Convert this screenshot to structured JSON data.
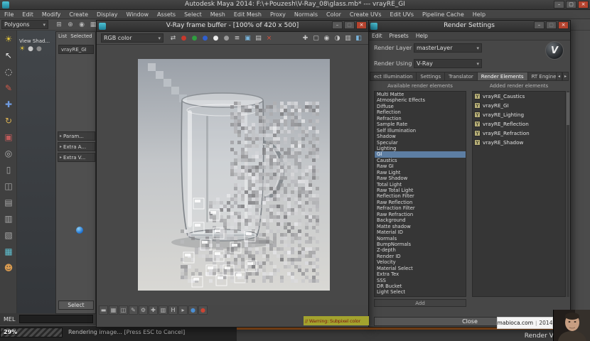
{
  "icons": {
    "minimize": "–",
    "maximize": "▢",
    "close": "×",
    "dropdown_arrow": "▾",
    "section_arrow": "▸",
    "tab_scroll_left": "◂",
    "tab_scroll_right": "▸"
  },
  "maya": {
    "title": "Autodesk Maya 2014: F:\\+Pouzesh\\V-Ray_08\\glass.mb* --- vrayRE_GI",
    "menus": [
      "File",
      "Edit",
      "Modify",
      "Create",
      "Display",
      "Window",
      "Assets",
      "Select",
      "Mesh",
      "Edit Mesh",
      "Proxy",
      "Normals",
      "Color",
      "Create UVs",
      "Edit UVs",
      "Pipeline Cache",
      "Help"
    ],
    "menuset": "Polygons",
    "panel_menu_hint": "View Shad...",
    "mel_label": "MEL",
    "progress_percent": "29%",
    "help_line": "Rendering image... [Press ESC to Cancel]",
    "warning_line": "// Warning: Subpixel color",
    "render_view_label": "Render View",
    "watermark_site": "mabioca.com",
    "watermark_sep": "|",
    "watermark_year": "2014",
    "toolbox_icons": [
      {
        "name": "render-light-icon",
        "glyph": "☀",
        "color": "#e3c43a"
      },
      {
        "name": "select-tool-icon",
        "glyph": "↖",
        "color": "#e8e8e8"
      },
      {
        "name": "lasso-tool-icon",
        "glyph": "◌",
        "color": "#d8d8d8"
      },
      {
        "name": "paint-select-tool-icon",
        "glyph": "✎",
        "color": "#d05a4a"
      },
      {
        "name": "move-tool-icon",
        "glyph": "✚",
        "color": "#6f9be0"
      },
      {
        "name": "rotate-tool-icon",
        "glyph": "↻",
        "color": "#d8b052"
      },
      {
        "name": "scale-tool-icon",
        "glyph": "▣",
        "color": "#c05a5a"
      },
      {
        "name": "last-tool-icon",
        "glyph": "◎",
        "color": "#b0b0b0"
      },
      {
        "name": "layout-single-icon",
        "glyph": "▯",
        "color": "#a8a8a8"
      },
      {
        "name": "layout-four-icon",
        "glyph": "◫",
        "color": "#a8a8a8"
      },
      {
        "name": "layout-split-icon",
        "glyph": "▤",
        "color": "#a8a8a8"
      },
      {
        "name": "layout-persp-outliner-icon",
        "glyph": "▥",
        "color": "#a8a8a8"
      },
      {
        "name": "layout-hypershade-icon",
        "glyph": "▧",
        "color": "#a8a8a8"
      },
      {
        "name": "grid-snap-icon",
        "glyph": "▦",
        "color": "#5fc0d0"
      },
      {
        "name": "character-icon",
        "glyph": "☻",
        "color": "#d89a50"
      }
    ],
    "shelf_icons": [
      {
        "name": "snap-grid-icon",
        "glyph": "⊞",
        "color": "#b8b8b8"
      },
      {
        "name": "snap-curve-icon",
        "glyph": "⊕",
        "color": "#b8b8b8"
      },
      {
        "name": "snap-point-icon",
        "glyph": "◉",
        "color": "#b8b8b8"
      },
      {
        "name": "snap-view-icon",
        "glyph": "▦",
        "color": "#b8b8b8"
      }
    ],
    "viewport_icons": [
      {
        "name": "viewport-light-icon",
        "glyph": "☀",
        "color": "#e3c43a"
      },
      {
        "name": "viewport-sphere-icon",
        "glyph": "●",
        "color": "#c8c8c8"
      },
      {
        "name": "viewport-sphere2-icon",
        "glyph": "●",
        "color": "#8a8a8a"
      }
    ]
  },
  "attribute_editor": {
    "menus": [
      "List",
      "Selected"
    ],
    "tab": "vrayRE_GI",
    "sections": [
      "Param...",
      "Extra A...",
      "Extra V..."
    ],
    "select_button": "Select"
  },
  "framebuffer": {
    "title": "V-Ray frame buffer - [100% of 420 x 500]",
    "channel": "RGB color",
    "toolbar_icons_left": [
      {
        "name": "swap-buffers-icon",
        "glyph": "⇄",
        "color": "#d0d0d0"
      },
      {
        "name": "red-channel-icon",
        "glyph": "●",
        "color": "#c8382c"
      },
      {
        "name": "green-channel-icon",
        "glyph": "●",
        "color": "#2f9e3f"
      },
      {
        "name": "blue-channel-icon",
        "glyph": "●",
        "color": "#2f5fd0"
      },
      {
        "name": "alpha-channel-icon",
        "glyph": "●",
        "color": "#ececec"
      },
      {
        "name": "mono-channel-icon",
        "glyph": "●",
        "color": "#9a9a9a"
      },
      {
        "name": "channels-menu-icon",
        "glyph": "≡",
        "color": "#d8d8d8"
      },
      {
        "name": "save-image-icon",
        "glyph": "▣",
        "color": "#79b5dd"
      },
      {
        "name": "load-image-icon",
        "glyph": "▤",
        "color": "#c8c8c8"
      },
      {
        "name": "clear-image-icon",
        "glyph": "×",
        "color": "#d8503c"
      }
    ],
    "toolbar_icons_right": [
      {
        "name": "follow-mouse-icon",
        "glyph": "✚",
        "color": "#c8c8c8"
      },
      {
        "name": "region-render-icon",
        "glyph": "▢",
        "color": "#c8c8c8"
      },
      {
        "name": "pixel-info-icon",
        "glyph": "◉",
        "color": "#c8c8c8"
      },
      {
        "name": "color-correction-icon",
        "glyph": "◑",
        "color": "#c8c8c8"
      },
      {
        "name": "levels-icon",
        "glyph": "▥",
        "color": "#c8c8c8"
      },
      {
        "name": "compare-icon",
        "glyph": "◧",
        "color": "#79b5dd"
      }
    ],
    "bottom_icons": [
      {
        "name": "minimize-panel-icon",
        "glyph": "▬",
        "color": "#b8b8b8"
      },
      {
        "name": "show-alpha-icon",
        "glyph": "▦",
        "color": "#b8b8b8"
      },
      {
        "name": "pixel-aspect-icon",
        "glyph": "◫",
        "color": "#b8b8b8"
      },
      {
        "name": "stamp-edit-icon",
        "glyph": "✎",
        "color": "#b8b8b8"
      },
      {
        "name": "settings-gear-icon",
        "glyph": "⚙",
        "color": "#b8b8b8"
      },
      {
        "name": "crosshair-icon",
        "glyph": "✚",
        "color": "#b8b8b8"
      },
      {
        "name": "histogram-icon",
        "glyph": "▥",
        "color": "#b8b8b8"
      },
      {
        "name": "h-shortcut-icon",
        "glyph": "H",
        "color": "#c8c8c8"
      },
      {
        "name": "play-icon",
        "glyph": "▸",
        "color": "#b8b8b8"
      },
      {
        "name": "blue-dot-icon",
        "glyph": "●",
        "color": "#4a8fd4"
      },
      {
        "name": "red-dot-icon",
        "glyph": "●",
        "color": "#cc4433"
      }
    ]
  },
  "render_settings": {
    "title": "Render Settings",
    "menus": [
      "Edit",
      "Presets",
      "Help"
    ],
    "logo_letter": "V",
    "render_layer_label": "Render Layer",
    "render_layer_value": "masterLayer",
    "render_using_label": "Render Using",
    "render_using_value": "V-Ray",
    "tabs": [
      "ect Illumination",
      "Settings",
      "Translator",
      "Render Elements",
      "RT Engine"
    ],
    "active_tab": "Render Elements",
    "available_header": "Available render elements",
    "added_header": "Added render elements",
    "available": [
      "Multi Matte",
      "Atmospheric Effects",
      "Diffuse",
      "Reflection",
      "Refraction",
      "Sample Rate",
      "Self Illumination",
      "Shadow",
      "Specular",
      "Lighting",
      "GI",
      "Caustics",
      "Raw GI",
      "Raw Light",
      "Raw Shadow",
      "Total Light",
      "Raw Total Light",
      "Reflection Filter",
      "Raw Reflection",
      "Refraction Filter",
      "Raw Refraction",
      "Background",
      "Matte shadow",
      "Material ID",
      "Normals",
      "BumpNormals",
      "Z-depth",
      "Render ID",
      "Velocity",
      "Material Select",
      "Extra Tex",
      "SSS",
      "DR Bucket",
      "Light Select"
    ],
    "selected_available": "GI",
    "enabled_glyph": "Y",
    "added": [
      "vrayRE_Caustics",
      "vrayRE_GI",
      "vrayRE_Lighting",
      "vrayRE_Reflection",
      "vrayRE_Refraction",
      "vrayRE_Shadow"
    ],
    "add_button": "Add",
    "close_button": "Close"
  }
}
